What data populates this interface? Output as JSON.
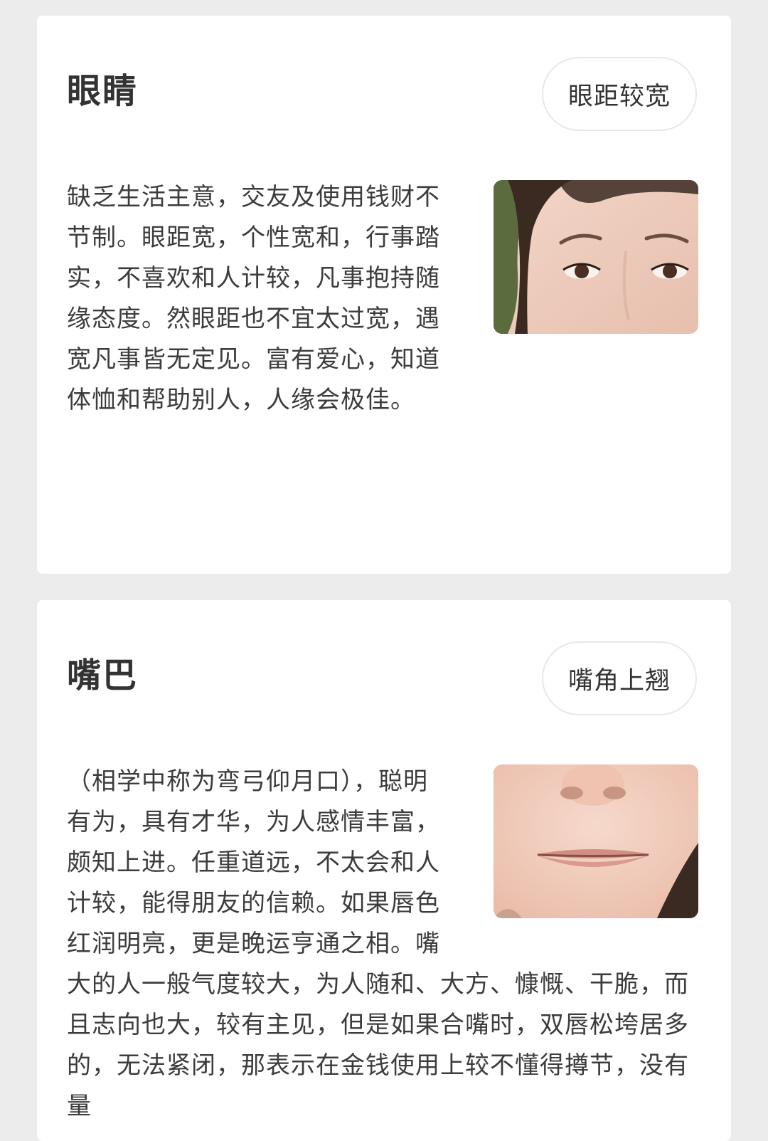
{
  "cards": [
    {
      "title": "眼睛",
      "tag": "眼距较宽",
      "image": "face-eyes-photo",
      "text": "缺乏生活主意，交友及使用钱财不节制。眼距宽，个性宽和，行事踏实，不喜欢和人计较，凡事抱持随缘态度。然眼距也不宜太过宽，遇宽凡事皆无定见。富有爱心，知道体恤和帮助别人，人缘会极佳。"
    },
    {
      "title": "嘴巴",
      "tag": "嘴角上翘",
      "image": "face-mouth-photo",
      "text": "（相学中称为弯弓仰月口），聪明有为，具有才华，为人感情丰富，颇知上进。任重道远，不太会和人计较，能得朋友的信赖。如果唇色红润明亮，更是晚运亨通之相。嘴大的人一般气度较大，为人随和、大方、慷慨、干脆，而且志向也大，较有主见，但是如果合嘴时，双唇松垮居多的，无法紧闭，那表示在金钱使用上较不懂得撙节，没有量"
    }
  ]
}
